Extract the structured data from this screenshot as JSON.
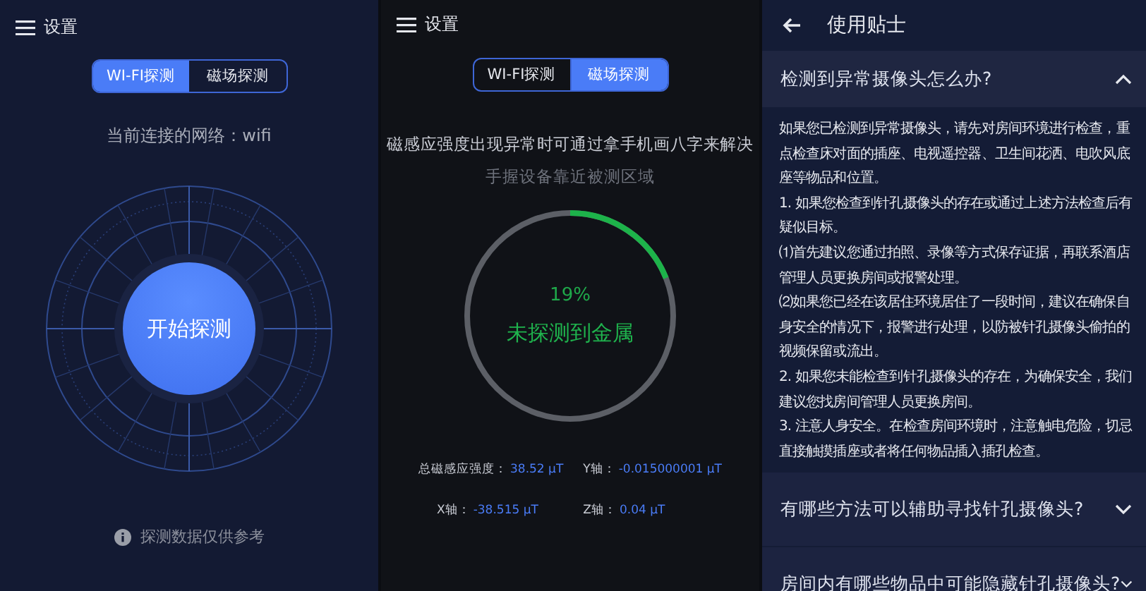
{
  "wifi_screen": {
    "menu_label": "设置",
    "tabs": [
      {
        "label": "WI-FI探测",
        "selected": true
      },
      {
        "label": "磁场探测",
        "selected": false
      }
    ],
    "network": "当前连接的网络：wifi",
    "start_button": "开始探测",
    "footnote": "探测数据仅供参考"
  },
  "magnet_screen": {
    "menu_label": "设置",
    "tabs": [
      {
        "label": "WI-FI探测",
        "selected": false
      },
      {
        "label": "磁场探测",
        "selected": true
      }
    ],
    "hint": "磁感应强度出现异常时可通过拿手机画八字来解决",
    "instruction": "手握设备靠近被测区域",
    "gauge": {
      "level": 0.19,
      "percent": "19%",
      "status": "未探测到金属"
    },
    "readings": [
      {
        "label": "总磁感应强度：",
        "value": "38.52 μT"
      },
      {
        "label": "Y轴：",
        "value": "-0.015000001 μT"
      },
      {
        "label": "X轴：",
        "value": "-38.515 μT"
      },
      {
        "label": "Z轴：",
        "value": "0.04 μT"
      }
    ]
  },
  "tips_screen": {
    "title": "使用贴士",
    "faq": [
      {
        "question": "检测到异常摄像头怎么办?",
        "expanded": true,
        "answer": [
          "如果您已检测到异常摄像头，请先对房间环境进行检查，重点检查床对面的插座、电视遥控器、卫生间花洒、电吹风底座等物品和位置。",
          "1. 如果您检查到针孔摄像头的存在或通过上述方法检查后有疑似目标。",
          "⑴首先建议您通过拍照、录像等方式保存证据，再联系酒店管理人员更换房间或报警处理。",
          "⑵如果您已经在该居住环境居住了一段时间，建议在确保自身安全的情况下，报警进行处理，以防被针孔摄像头偷拍的视频保留或流出。",
          "2. 如果您未能检查到针孔摄像头的存在，为确保安全，我们建议您找房间管理人员更换房间。",
          "3. 注意人身安全。在检查房间环境时，注意触电危险，切忌直接触摸插座或者将任何物品插入插孔检查。"
        ]
      },
      {
        "question": "有哪些方法可以辅助寻找针孔摄像头?",
        "expanded": false
      },
      {
        "question": "房间内有哪些物品中可能隐藏针孔摄像头?",
        "expanded": false
      }
    ]
  }
}
